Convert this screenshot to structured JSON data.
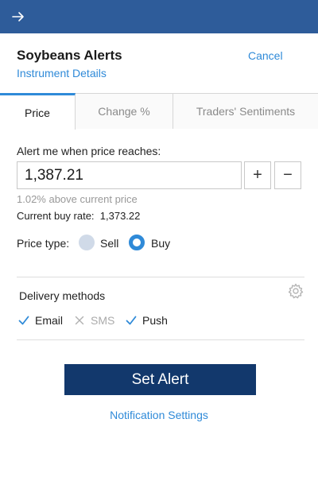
{
  "header": {
    "back_icon": "arrow-right-icon",
    "bar_color": "#2e5c9a"
  },
  "dialog": {
    "title": "Soybeans Alerts",
    "subtitle_link": "Instrument Details",
    "cancel_label": "Cancel"
  },
  "tabs": [
    {
      "label": "Price",
      "active": true
    },
    {
      "label": "Change %",
      "active": false
    },
    {
      "label": "Traders' Sentiments",
      "active": false
    }
  ],
  "price_alert": {
    "label": "Alert me when price reaches:",
    "value": "1,387.21",
    "plus_label": "+",
    "minus_label": "−",
    "hint": "1.02% above current price",
    "current_buy_rate": "Current buy rate:  1,373.22"
  },
  "price_type": {
    "label": "Price type:",
    "options": [
      {
        "label": "Sell",
        "selected": false
      },
      {
        "label": "Buy",
        "selected": true
      }
    ]
  },
  "delivery": {
    "label": "Delivery methods",
    "settings_icon": "gear-icon",
    "methods": [
      {
        "label": "Email",
        "enabled": true,
        "icon": "check-icon"
      },
      {
        "label": "SMS",
        "enabled": false,
        "icon": "x-icon"
      },
      {
        "label": "Push",
        "enabled": true,
        "icon": "check-icon"
      }
    ]
  },
  "actions": {
    "set_alert_label": "Set Alert",
    "notification_settings_label": "Notification Settings"
  },
  "colors": {
    "accent": "#2f8ad8",
    "primary_button": "#12386c"
  }
}
